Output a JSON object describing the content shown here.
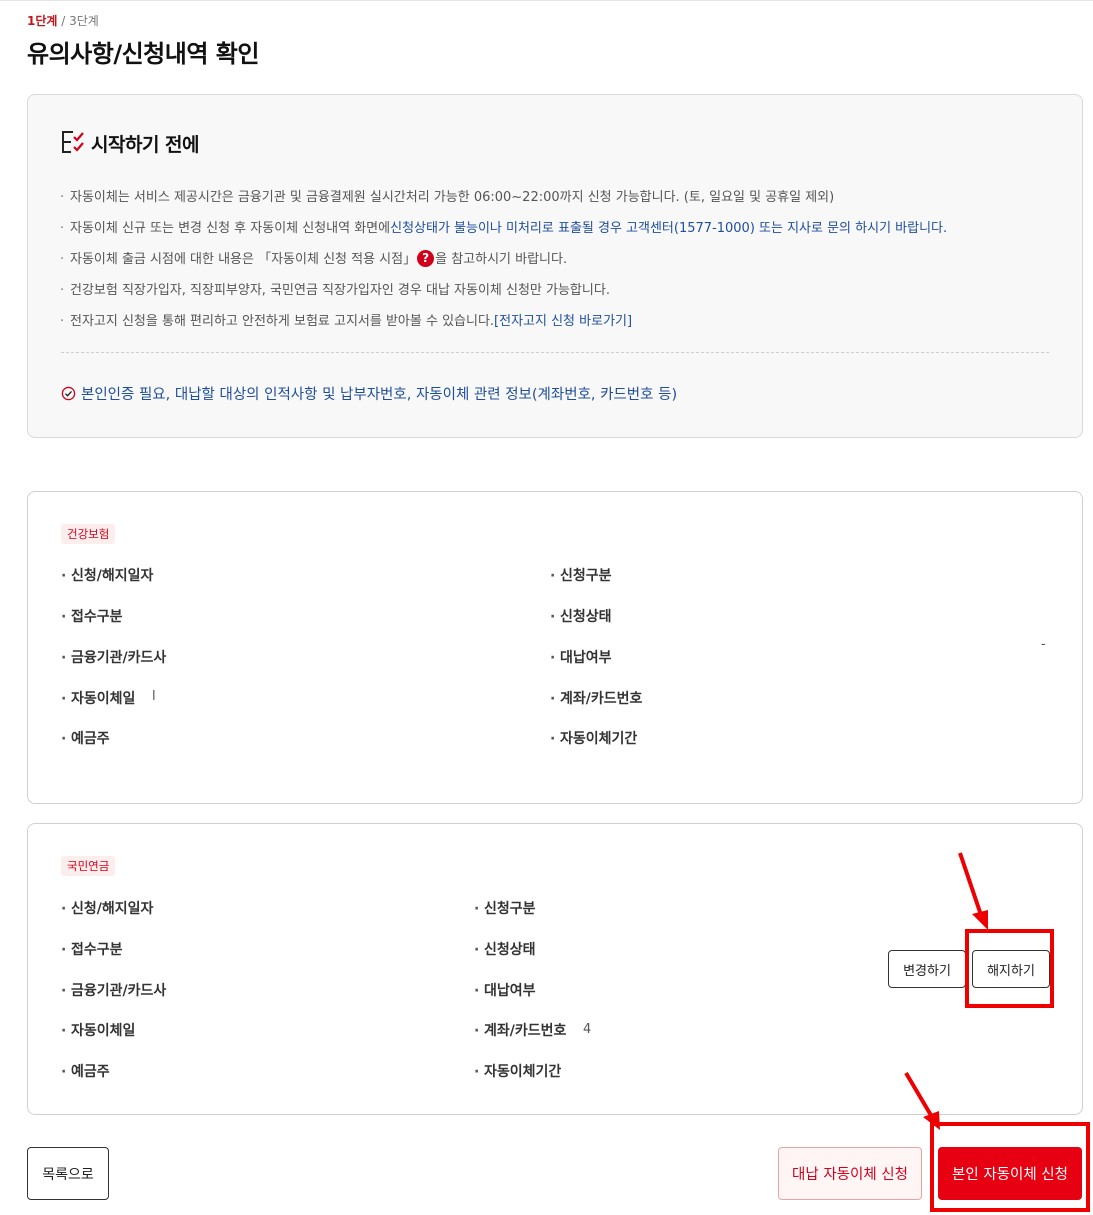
{
  "header": {
    "step_current": "1단계",
    "step_sep": " / ",
    "step_total": "3단계",
    "title": "유의사항/신청내역 확인"
  },
  "notice": {
    "heading": "시작하기 전에",
    "heading_icon": "checklist-icon",
    "items": [
      {
        "text": "자동이체는 서비스 제공시간은 금융기관 및 금융결제원 실시간처리 가능한 06:00~22:00까지 신청 가능합니다. (토, 일요일 및 공휴일 제외)"
      },
      {
        "text": "자동이체 신규 또는 변경 신청 후 자동이체 신청내역 화면에 ",
        "highlight": "신청상태가 불능이나 미처리로 표출될 경우 고객센터(1577-1000) 또는 지사로 문의 하시기 바랍니다."
      },
      {
        "text_before": "자동이체 출금 시점에 대한 내용은 「자동이체 신청 적용 시점」",
        "help_icon": "?",
        "text_after": "을 참고하시기 바랍니다."
      },
      {
        "text": "건강보험 직장가입자, 직장피부양자, 국민연금 직장가입자인 경우 대납 자동이체 신청만 가능합니다."
      },
      {
        "text": "전자고지 신청을 통해 편리하고 안전하게 보험료 고지서를 받아볼 수 있습니다.",
        "link": "[전자고지 신청 바로가기]"
      }
    ],
    "requirement": "본인인증 필요, 대납할 대상의 인적사항 및 납부자번호, 자동이체 관련 정보(계좌번호, 카드번호 등)"
  },
  "health": {
    "tag": "건강보험",
    "left_fields": [
      "신청/해지일자",
      "접수구분",
      "금융기관/카드사",
      "자동이체일",
      "예금주"
    ],
    "right_fields": [
      "신청구분",
      "신청상태",
      "대납여부",
      "계좌/카드번호",
      "자동이체기간"
    ],
    "autopay_day_value": "l",
    "action_value": "-"
  },
  "pension": {
    "tag": "국민연금",
    "left_fields": [
      "신청/해지일자",
      "접수구분",
      "금융기관/카드사",
      "자동이체일",
      "예금주"
    ],
    "right_fields": [
      "신청구분",
      "신청상태",
      "대납여부",
      "계좌/카드번호",
      "자동이체기간"
    ],
    "account_value": "4",
    "change_label": "변경하기",
    "cancel_label": "해지하기"
  },
  "footer": {
    "list_label": "목록으로",
    "proxy_label": "대납 자동이체 신청",
    "self_label": "본인 자동이체 신청"
  },
  "colors": {
    "accent_red": "#e60012",
    "link_blue": "#1f4e9c",
    "annotation_red": "#ee0000"
  }
}
